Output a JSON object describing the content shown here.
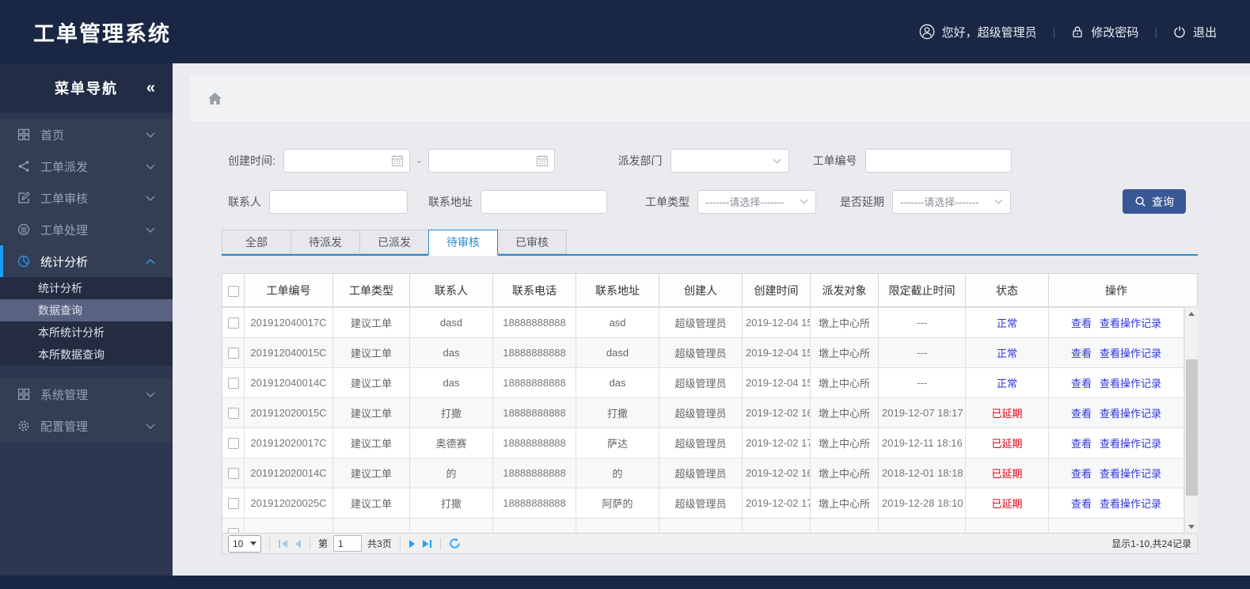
{
  "header": {
    "title": "工单管理系统",
    "greeting": "您好，超级管理员",
    "change_password": "修改密码",
    "logout": "退出",
    "icons": [
      "user-circle-icon",
      "lock-icon",
      "power-icon"
    ]
  },
  "sidebar": {
    "title": "菜单导航",
    "collapse_glyph": "«",
    "items": [
      {
        "label": "首页",
        "icon": "grid-icon"
      },
      {
        "label": "工单派发",
        "icon": "share-icon"
      },
      {
        "label": "工单审核",
        "icon": "edit-icon"
      },
      {
        "label": "工单处理",
        "icon": "process-icon"
      },
      {
        "label": "统计分析",
        "icon": "pie-chart-icon",
        "active": true,
        "expanded": true
      },
      {
        "label": "系统管理",
        "icon": "apps-icon"
      },
      {
        "label": "配置管理",
        "icon": "gear-icon"
      }
    ],
    "statistics_children": [
      "统计分析",
      "数据查询",
      "本所统计分析",
      "本所数据查询"
    ],
    "selected_child": "数据查询"
  },
  "filters": {
    "created_time_label": "创建时间:",
    "date_from_value": "",
    "date_to_value": "",
    "range_separator": "-",
    "dispatch_dept_label": "派发部门",
    "dispatch_dept_value": "",
    "order_no_label": "工单编号",
    "order_no_value": "",
    "contact_label": "联系人",
    "contact_value": "",
    "address_label": "联系地址",
    "address_value": "",
    "order_type_label": "工单类型",
    "order_type_value": "-------请选择-------",
    "delayed_label": "是否延期",
    "delayed_value": "-------请选择-------",
    "search_button": "查询"
  },
  "tabs": {
    "items": [
      "全部",
      "待派发",
      "已派发",
      "待审核",
      "已审核"
    ],
    "active": "待审核"
  },
  "table": {
    "columns": [
      "工单编号",
      "工单类型",
      "联系人",
      "联系电话",
      "联系地址",
      "创建人",
      "创建时间",
      "派发对象",
      "限定截止时间",
      "状态",
      "操作"
    ],
    "actions": {
      "view": "查看",
      "view_log": "查看操作记录"
    },
    "rows": [
      {
        "no": "201912040017C",
        "type": "建议工单",
        "contact": "dasd",
        "phone": "18888888888",
        "address": "asd",
        "creator": "超级管理员",
        "created": "2019-12-04 15",
        "target": "墩上中心所",
        "deadline": "---",
        "status": "正常",
        "status_type": "normal"
      },
      {
        "no": "201912040015C",
        "type": "建议工单",
        "contact": "das",
        "phone": "18888888888",
        "address": "dasd",
        "creator": "超级管理员",
        "created": "2019-12-04 15",
        "target": "墩上中心所",
        "deadline": "---",
        "status": "正常",
        "status_type": "normal"
      },
      {
        "no": "201912040014C",
        "type": "建议工单",
        "contact": "das",
        "phone": "18888888888",
        "address": "das",
        "creator": "超级管理员",
        "created": "2019-12-04 15",
        "target": "墩上中心所",
        "deadline": "---",
        "status": "正常",
        "status_type": "normal"
      },
      {
        "no": "201912020015C",
        "type": "建议工单",
        "contact": "打撒",
        "phone": "18888888888",
        "address": "打撒",
        "creator": "超级管理员",
        "created": "2019-12-02 16",
        "target": "墩上中心所",
        "deadline": "2019-12-07 18:17",
        "status": "已延期",
        "status_type": "delayed"
      },
      {
        "no": "201912020017C",
        "type": "建议工单",
        "contact": "奥德赛",
        "phone": "18888888888",
        "address": "萨达",
        "creator": "超级管理员",
        "created": "2019-12-02 17",
        "target": "墩上中心所",
        "deadline": "2019-12-11 18:16",
        "status": "已延期",
        "status_type": "delayed"
      },
      {
        "no": "201912020014C",
        "type": "建议工单",
        "contact": "的",
        "phone": "18888888888",
        "address": "的",
        "creator": "超级管理员",
        "created": "2019-12-02 16",
        "target": "墩上中心所",
        "deadline": "2018-12-01 18:18",
        "status": "已延期",
        "status_type": "delayed"
      },
      {
        "no": "201912020025C",
        "type": "建议工单",
        "contact": "打撒",
        "phone": "18888888888",
        "address": "阿萨的",
        "creator": "超级管理员",
        "created": "2019-12-02 17",
        "target": "墩上中心所",
        "deadline": "2019-12-28 18:10",
        "status": "已延期",
        "status_type": "delayed"
      },
      {
        "no": "",
        "type": "",
        "contact": "",
        "phone": "",
        "address": "",
        "creator": "",
        "created": "",
        "target": "",
        "deadline": "",
        "status": "",
        "status_type": "",
        "partial": true
      }
    ]
  },
  "pagination": {
    "page_size": "10",
    "page_label_prefix": "第",
    "current_page": "1",
    "total_pages_label": "共3页",
    "summary": "显示1-10,共24记录"
  },
  "colors": {
    "header_navy": "#1a2744",
    "accent_blue": "#1e9dff",
    "tab_blue": "#2888cf",
    "link_blue": "#2f35d8",
    "danger_red": "#e60012",
    "search_button_navy": "#3a5795"
  }
}
